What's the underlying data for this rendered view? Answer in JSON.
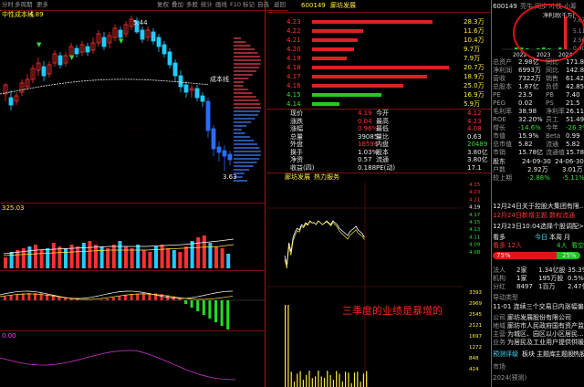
{
  "left_toolbar": {
    "items": [
      "分时",
      "多周期",
      "更多"
    ],
    "buttons": [
      "复权",
      "叠加",
      "多股",
      "统计",
      "画线",
      "F10",
      "标记",
      "自选",
      "返回"
    ]
  },
  "main_chart": {
    "indicator_label": "中性成本线",
    "indicator_value": "4.89",
    "high_label": "5.44",
    "chengben_label": "成本线",
    "low_label": "3.63"
  },
  "volume_panel": {
    "label": "325.03"
  },
  "macd_panel": {},
  "sub_panel": {
    "label": "0.00"
  },
  "stock": {
    "code": "600149",
    "name": "廊坊发展"
  },
  "order_book": {
    "asks": [
      {
        "price": "4.23",
        "vol": "28.3万"
      },
      {
        "price": "4.22",
        "vol": "11.6万"
      },
      {
        "price": "4.21",
        "vol": "10.4万"
      },
      {
        "price": "4.20",
        "vol": "9.7万"
      },
      {
        "price": "4.19",
        "vol": "7.9万"
      }
    ],
    "bids": [
      {
        "price": "4.18",
        "vol": "20.7万"
      },
      {
        "price": "4.17",
        "vol": "18.9万"
      },
      {
        "price": "4.16",
        "vol": "25.0万"
      },
      {
        "price": "4.15",
        "vol": "16.9万"
      },
      {
        "price": "4.14",
        "vol": "5.9万"
      }
    ]
  },
  "quote_stats": [
    {
      "l1": "现价",
      "v1": "4.19",
      "l2": "今开",
      "v2": "4.12"
    },
    {
      "l1": "涨跌",
      "v1": "0.04",
      "l2": "最高",
      "v2": "4.23"
    },
    {
      "l1": "涨幅",
      "v1": "0.96%",
      "l2": "最低",
      "v2": "4.08"
    },
    {
      "l1": "总量",
      "v1": "39085",
      "l2": "量比",
      "v2": "0.63"
    },
    {
      "l1": "外盘",
      "v1": "18596",
      "l2": "内盘",
      "v2": "20489"
    },
    {
      "l1": "换手",
      "v1": "1.03%",
      "l2": "股本",
      "v2": "3.80亿"
    },
    {
      "l1": "净资",
      "v1": "0.57",
      "l2": "流通",
      "v2": "3.80亿"
    },
    {
      "l1": "收益(四)",
      "v1": "0.188",
      "l2": "PE(动)",
      "v2": "17.1"
    }
  ],
  "intraday": {
    "tabs": [
      "廊坊发展",
      "热力服务"
    ],
    "price_axis": [
      "4.25",
      "4.23",
      "4.21",
      "4.19",
      "4.17",
      "4.15",
      "4.13",
      "4.11",
      "4.09",
      "4.08"
    ],
    "pct_axis": [
      "1.44%",
      "0.96%",
      "0.48%",
      "0.00%",
      "0.48%",
      "0.96%",
      "1.44%",
      "1.92%",
      "2.40%",
      "2.64%"
    ],
    "vol_axis": [
      "3393",
      "2969",
      "2545",
      "2121",
      "1697",
      "1272",
      "848",
      "424"
    ],
    "annotation": "三季度的业绩是暴增的"
  },
  "right_panel": {
    "header_code": "600149",
    "header_tabs": [
      "亮牛",
      "同步",
      "叶枝",
      "小筹"
    ],
    "net_profit_label": "净利润(千万)",
    "bar_labels": {
      "y_top": "7.67",
      "y_mid": "5.11",
      "y_low": "2.56",
      "y_zero": "0.00"
    },
    "years": [
      "2022",
      "2023",
      "2024"
    ],
    "fin_rows": [
      {
        "l": "总资产",
        "v": "2.98亿",
        "l2": "同比",
        "v2": "171.89"
      },
      {
        "l": "净利润",
        "v": "6993万",
        "l2": "同比",
        "v2": "142.86"
      },
      {
        "l": "营收",
        "v": "7322万",
        "l2": "销售",
        "v2": "61.42%"
      },
      {
        "l": "总股本",
        "v": "1.87亿",
        "l2": "负债",
        "v2": "42.85%"
      },
      {
        "l": "PE",
        "v": "23.5",
        "l2": "PB",
        "v2": "7.40"
      },
      {
        "l": "PEG",
        "v": "0.02",
        "l2": "PS",
        "v2": "21.5"
      },
      {
        "l": "毛利率",
        "v": "38.98",
        "l2": "净利率",
        "v2": "26.11"
      },
      {
        "l": "ROE",
        "v": "32.20%",
        "l2": "员工",
        "v2": "51.49"
      },
      {
        "l": "增长",
        "v": "-14.6%",
        "l2": "今年",
        "v2": "-26.3%"
      },
      {
        "l": "市值",
        "v": "15.9%",
        "l2": "Beta",
        "v2": "0.99"
      },
      {
        "l": "总市值",
        "v": "5.82",
        "l2": "流通",
        "v2": "5.82"
      },
      {
        "l": "市销",
        "v": "15.78亿",
        "l2": "流通值",
        "v2": "15.78亿"
      }
    ],
    "holders": {
      "label": "股东",
      "date1": "24-09-30",
      "date2": "24-06-30",
      "row1_l": "户数",
      "row1_a": "2.92万",
      "row1_b": "3.01万",
      "row2_l": "较上期",
      "row2_a": "-2.88%",
      "row2_b": "-5.11%"
    },
    "news": [
      "12月24日关于控股大集团有限...",
      "12月24日新增主题 数权流通",
      "12月23日10:04选择个股调配>"
    ],
    "poll": {
      "label": "看多",
      "bull_count": "12人",
      "bear_count": "4人",
      "bull_label": "看多",
      "bear_label": "看空",
      "tab1": "今日",
      "tab2": "本周",
      "tab3": "月",
      "bull_pct": "75%",
      "bear_pct": "25%"
    },
    "ratings": [
      {
        "l": "法人",
        "v": "2家",
        "v2": "1.34亿股",
        "v3": "35.3%"
      },
      {
        "l": "机构",
        "v": "1家",
        "v2": "195万股",
        "v3": "0.5%"
      },
      {
        "l": "分红",
        "v": "8497",
        "v2": "1百万",
        "v3": "2.47亿股"
      }
    ],
    "events_label": "导动类型",
    "event": "11-01 连续三个交易日内涨幅偏...",
    "company": [
      {
        "l": "公司",
        "v": "廊坊发展股份有限公司"
      },
      {
        "l": "地域",
        "v": "廊坊市人民政府国有资产监..."
      },
      {
        "l": "主营",
        "v": "为城区、园区以小区居民..."
      },
      {
        "l": "业务",
        "v": "为居民及工业用户提供供暖..."
      }
    ],
    "bottom_tabs": [
      "预测评级",
      "板块",
      "主题库",
      "主题股",
      "热股"
    ],
    "bottom": [
      {
        "l": "市场",
        "v": ""
      },
      {
        "l": "2024(预测)",
        "v": ""
      }
    ]
  },
  "colors": {
    "up": "#ff3333",
    "down": "#33dd33",
    "panel_border": "#7a1010",
    "accent_red": "#ff0000"
  }
}
